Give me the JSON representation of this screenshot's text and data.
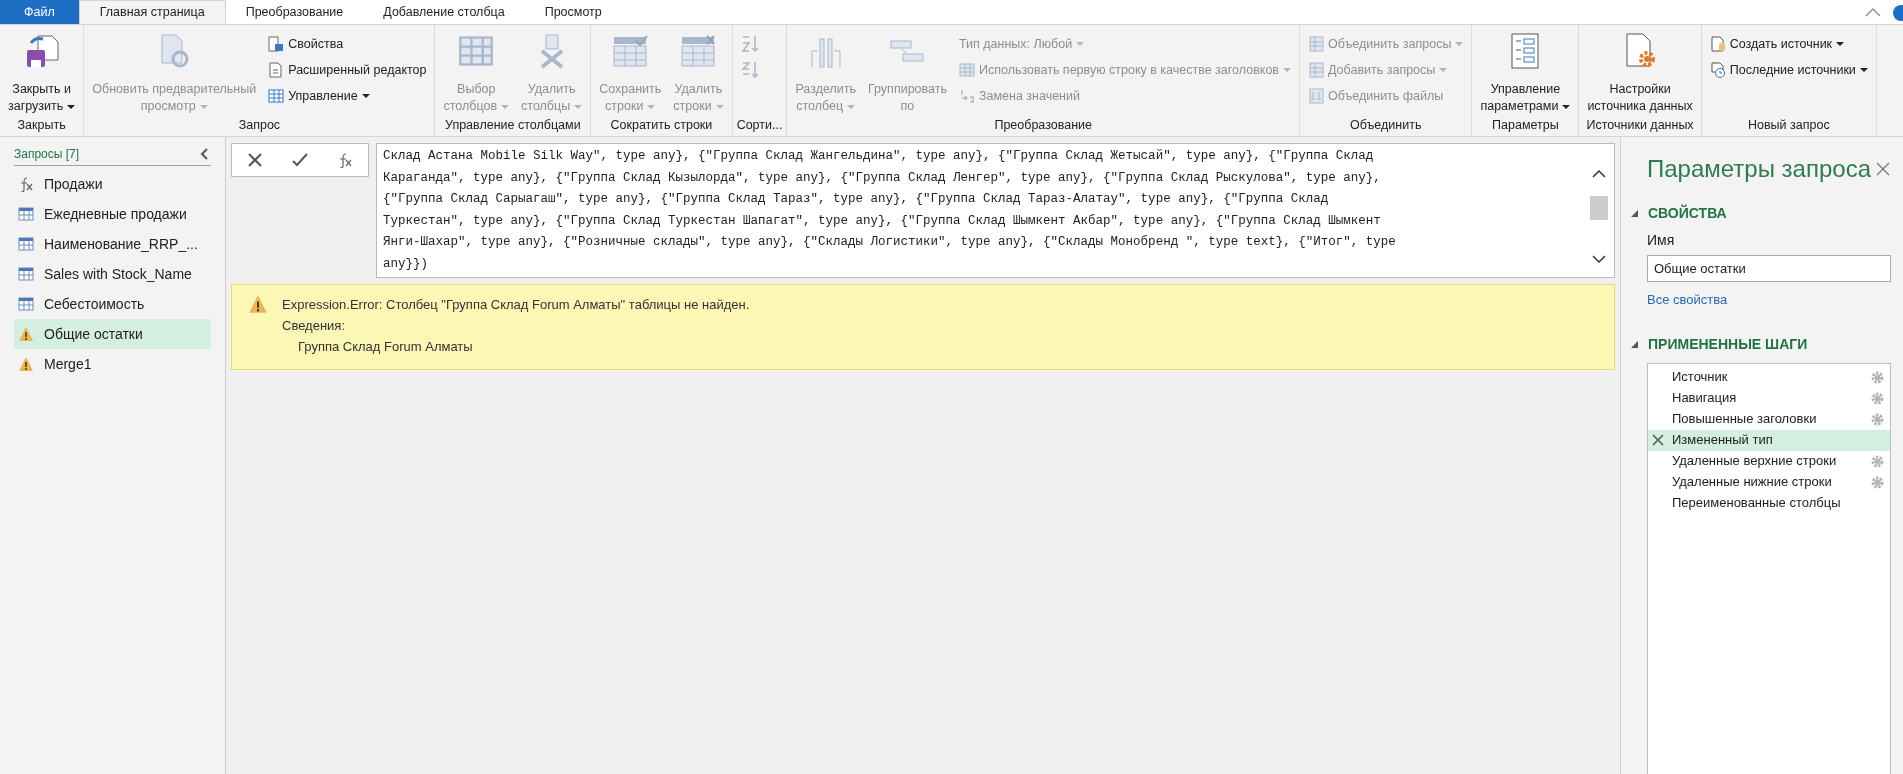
{
  "tabs": [
    {
      "label": "Файл",
      "kind": "file",
      "selected": false
    },
    {
      "label": "Главная страница",
      "kind": "tab",
      "selected": true
    },
    {
      "label": "Преобразование",
      "kind": "tab",
      "selected": false
    },
    {
      "label": "Добавление столбца",
      "kind": "tab",
      "selected": false
    },
    {
      "label": "Просмотр",
      "kind": "tab",
      "selected": false
    }
  ],
  "ribbon": [
    {
      "label": "Закрыть",
      "items": [
        {
          "kind": "large",
          "lines": [
            "Закрыть и",
            "загрузить"
          ],
          "dropdown": true,
          "disabled": false
        }
      ]
    },
    {
      "label": "Запрос",
      "items": [
        {
          "kind": "large",
          "lines": [
            "Обновить предварительный",
            "просмотр"
          ],
          "dropdown": true,
          "disabled": true
        },
        {
          "kind": "small",
          "lines": [
            "Свойства"
          ],
          "dropdown": false,
          "disabled": false
        },
        {
          "kind": "small",
          "lines": [
            "Расширенный редактор"
          ],
          "dropdown": false,
          "disabled": false
        },
        {
          "kind": "small",
          "lines": [
            "Управление"
          ],
          "dropdown": true,
          "disabled": false
        }
      ]
    },
    {
      "label": "Управление столбцами",
      "items": [
        {
          "kind": "large",
          "lines": [
            "Выбор",
            "столбцов"
          ],
          "dropdown": true,
          "disabled": true
        },
        {
          "kind": "large",
          "lines": [
            "Удалить",
            "столбцы"
          ],
          "dropdown": true,
          "disabled": true
        }
      ]
    },
    {
      "label": "Сократить строки",
      "items": [
        {
          "kind": "large",
          "lines": [
            "Сохранить",
            "строки"
          ],
          "dropdown": true,
          "disabled": true
        },
        {
          "kind": "large",
          "lines": [
            "Удалить",
            "строки"
          ],
          "dropdown": true,
          "disabled": true
        }
      ]
    },
    {
      "label": "Сорти...",
      "items": [
        {
          "kind": "icon",
          "disabled": true
        },
        {
          "kind": "icon",
          "disabled": true
        }
      ]
    },
    {
      "label": "Преобразование",
      "items": [
        {
          "kind": "large",
          "lines": [
            "Разделить",
            "столбец"
          ],
          "dropdown": true,
          "disabled": true
        },
        {
          "kind": "large",
          "lines": [
            "Группировать",
            "по"
          ],
          "dropdown": false,
          "disabled": true
        },
        {
          "kind": "small",
          "lines": [
            "Тип данных: Любой"
          ],
          "dropdown": true,
          "disabled": true
        },
        {
          "kind": "small",
          "lines": [
            "Использовать первую строку в качестве заголовков"
          ],
          "dropdown": true,
          "disabled": true
        },
        {
          "kind": "small",
          "lines": [
            "Замена значений"
          ],
          "dropdown": false,
          "disabled": true
        }
      ]
    },
    {
      "label": "Объединить",
      "items": [
        {
          "kind": "small",
          "lines": [
            "Объединить запросы"
          ],
          "dropdown": true,
          "disabled": true
        },
        {
          "kind": "small",
          "lines": [
            "Добавить запросы"
          ],
          "dropdown": true,
          "disabled": true
        },
        {
          "kind": "small",
          "lines": [
            "Объединить файлы"
          ],
          "dropdown": false,
          "disabled": true
        }
      ]
    },
    {
      "label": "Параметры",
      "items": [
        {
          "kind": "large",
          "lines": [
            "Управление",
            "параметрами"
          ],
          "dropdown": true,
          "disabled": false
        }
      ]
    },
    {
      "label": "Источники данных",
      "items": [
        {
          "kind": "large",
          "lines": [
            "Настройки",
            "источника данных"
          ],
          "dropdown": false,
          "disabled": false
        }
      ]
    },
    {
      "label": "Новый запрос",
      "items": [
        {
          "kind": "small",
          "lines": [
            "Создать источник"
          ],
          "dropdown": true,
          "disabled": false
        },
        {
          "kind": "small",
          "lines": [
            "Последние источники"
          ],
          "dropdown": true,
          "disabled": false
        }
      ]
    }
  ],
  "queries": {
    "title": "Запросы [7]",
    "items": [
      {
        "label": "Продажи",
        "kind": "function",
        "selected": false
      },
      {
        "label": "Ежедневные продажи",
        "kind": "table",
        "selected": false
      },
      {
        "label": "Наименование_RRP_...",
        "kind": "table",
        "selected": false
      },
      {
        "label": "Sales with Stock_Name",
        "kind": "table",
        "selected": false
      },
      {
        "label": "Себестоимость",
        "kind": "table",
        "selected": false
      },
      {
        "label": "Общие остатки",
        "kind": "warning",
        "selected": true
      },
      {
        "label": "Merge1",
        "kind": "warning",
        "selected": false
      }
    ]
  },
  "formula": {
    "lines": [
      "Склад Астана Mobile Silk Way\", type any}, {\"Группа Склад Жангельдина\", type any}, {\"Группа Склад Жетысай\", type any}, {\"Группа Склад",
      "Караганда\", type any}, {\"Группа Склад Кызылорда\", type any}, {\"Группа Склад Ленгер\", type any}, {\"Группа Склад Рыскулова\", type any},",
      "{\"Группа Склад Сарыагаш\", type any}, {\"Группа Склад Тараз\", type any}, {\"Группа Склад Тараз-Алатау\", type any}, {\"Группа Склад",
      "Туркестан\", type any}, {\"Группа Склад Туркестан Шапагат\", type any}, {\"Группа Склад Шымкент Акбар\", type any}, {\"Группа Склад Шымкент",
      "Янги-Шахар\", type any}, {\"Розничные склады\", type any}, {\"Склады Логистики\", type any}, {\"Склады Монобренд \", type text}, {\"Итог\", type",
      "any}})"
    ]
  },
  "error": {
    "message": "Expression.Error: Столбец \"Группа Склад Forum Алматы\" таблицы не найден.",
    "details_label": "Сведения:",
    "details": "Группа Склад Forum Алматы"
  },
  "settings": {
    "title": "Параметры запроса",
    "properties_header": "СВОЙСТВА",
    "name_label": "Имя",
    "name_value": "Общие остатки",
    "all_properties": "Все свойства",
    "steps_header": "ПРИМЕНЕННЫЕ ШАГИ",
    "steps": [
      {
        "label": "Источник",
        "settings": true,
        "selected": false
      },
      {
        "label": "Навигация",
        "settings": true,
        "selected": false
      },
      {
        "label": "Повышенные заголовки",
        "settings": true,
        "selected": false
      },
      {
        "label": "Измененный тип",
        "settings": false,
        "selected": true
      },
      {
        "label": "Удаленные верхние строки",
        "settings": true,
        "selected": false
      },
      {
        "label": "Удаленные нижние строки",
        "settings": true,
        "selected": false
      },
      {
        "label": "Переименованные столбцы",
        "settings": false,
        "selected": false
      }
    ]
  }
}
